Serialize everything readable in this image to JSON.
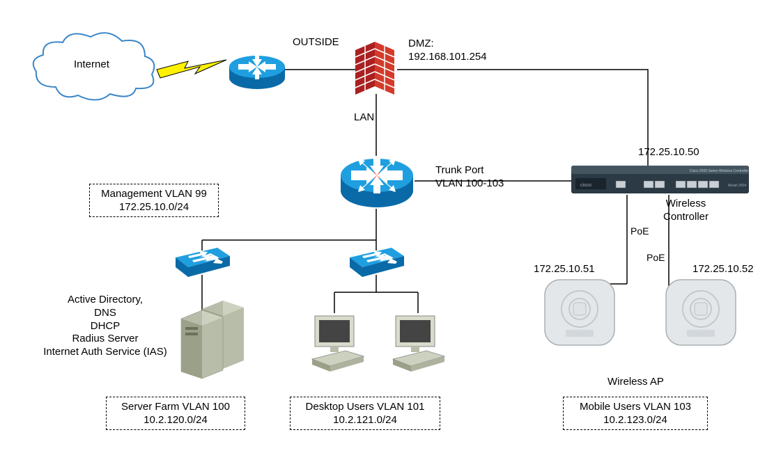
{
  "labels": {
    "internet": "Internet",
    "outside": "OUTSIDE",
    "dmz_title": "DMZ:",
    "dmz_ip": "192.168.101.254",
    "lan": "LAN",
    "wlc_ip": "172.25.10.50",
    "trunk_port": "Trunk Port",
    "trunk_vlans": "VLAN 100-103",
    "wireless_controller": "Wireless\nController",
    "poe1": "PoE",
    "poe2": "PoE",
    "ap1_ip": "172.25.10.51",
    "ap2_ip": "172.25.10.52",
    "wireless_ap": "Wireless AP",
    "services": "Active Directory,\nDNS\nDHCP\nRadius Server\nInternet Auth Service (IAS)"
  },
  "boxes": {
    "mgmt_vlan_line1": "Management VLAN 99",
    "mgmt_vlan_line2": "172.25.10.0/24",
    "server_farm_line1": "Server Farm VLAN 100",
    "server_farm_line2": "10.2.120.0/24",
    "desktop_line1": "Desktop Users VLAN 101",
    "desktop_line2": "10.2.121.0/24",
    "mobile_line1": "Mobile Users VLAN 103",
    "mobile_line2": "10.2.123.0/24"
  },
  "chart_data": {
    "type": "diagram",
    "title": "Network Topology",
    "nodes": [
      {
        "id": "internet",
        "name": "Internet",
        "type": "cloud"
      },
      {
        "id": "router",
        "name": "Edge Router",
        "type": "router"
      },
      {
        "id": "firewall",
        "name": "Firewall",
        "type": "firewall",
        "interfaces": {
          "outside": "OUTSIDE",
          "dmz": "192.168.101.254",
          "lan": "LAN"
        }
      },
      {
        "id": "core",
        "name": "Core L3 Switch",
        "type": "l3switch"
      },
      {
        "id": "wlc",
        "name": "Wireless Controller",
        "type": "wlc",
        "ip": "172.25.10.50"
      },
      {
        "id": "sw1",
        "name": "Access Switch 1",
        "type": "switch"
      },
      {
        "id": "sw2",
        "name": "Access Switch 2",
        "type": "switch"
      },
      {
        "id": "servers",
        "name": "Server Farm",
        "type": "server",
        "services": [
          "Active Directory",
          "DNS",
          "DHCP",
          "Radius Server",
          "Internet Auth Service (IAS)"
        ]
      },
      {
        "id": "pc1",
        "name": "Desktop 1",
        "type": "pc"
      },
      {
        "id": "pc2",
        "name": "Desktop 2",
        "type": "pc"
      },
      {
        "id": "ap1",
        "name": "Wireless AP 1",
        "type": "ap",
        "ip": "172.25.10.51"
      },
      {
        "id": "ap2",
        "name": "Wireless AP 2",
        "type": "ap",
        "ip": "172.25.10.52"
      }
    ],
    "links": [
      {
        "from": "internet",
        "to": "router",
        "media": "lightning"
      },
      {
        "from": "router",
        "to": "firewall",
        "label": "OUTSIDE"
      },
      {
        "from": "firewall",
        "to": "wlc",
        "label": "DMZ 192.168.101.254"
      },
      {
        "from": "firewall",
        "to": "core",
        "label": "LAN"
      },
      {
        "from": "core",
        "to": "wlc",
        "label": "Trunk Port VLAN 100-103"
      },
      {
        "from": "core",
        "to": "sw1"
      },
      {
        "from": "core",
        "to": "sw2"
      },
      {
        "from": "sw1",
        "to": "servers"
      },
      {
        "from": "sw2",
        "to": "pc1"
      },
      {
        "from": "sw2",
        "to": "pc2"
      },
      {
        "from": "wlc",
        "to": "ap1",
        "label": "PoE"
      },
      {
        "from": "wlc",
        "to": "ap2",
        "label": "PoE"
      }
    ],
    "vlans": [
      {
        "id": 99,
        "name": "Management",
        "subnet": "172.25.10.0/24"
      },
      {
        "id": 100,
        "name": "Server Farm",
        "subnet": "10.2.120.0/24"
      },
      {
        "id": 101,
        "name": "Desktop Users",
        "subnet": "10.2.121.0/24"
      },
      {
        "id": 103,
        "name": "Mobile Users",
        "subnet": "10.2.123.0/24"
      }
    ]
  }
}
